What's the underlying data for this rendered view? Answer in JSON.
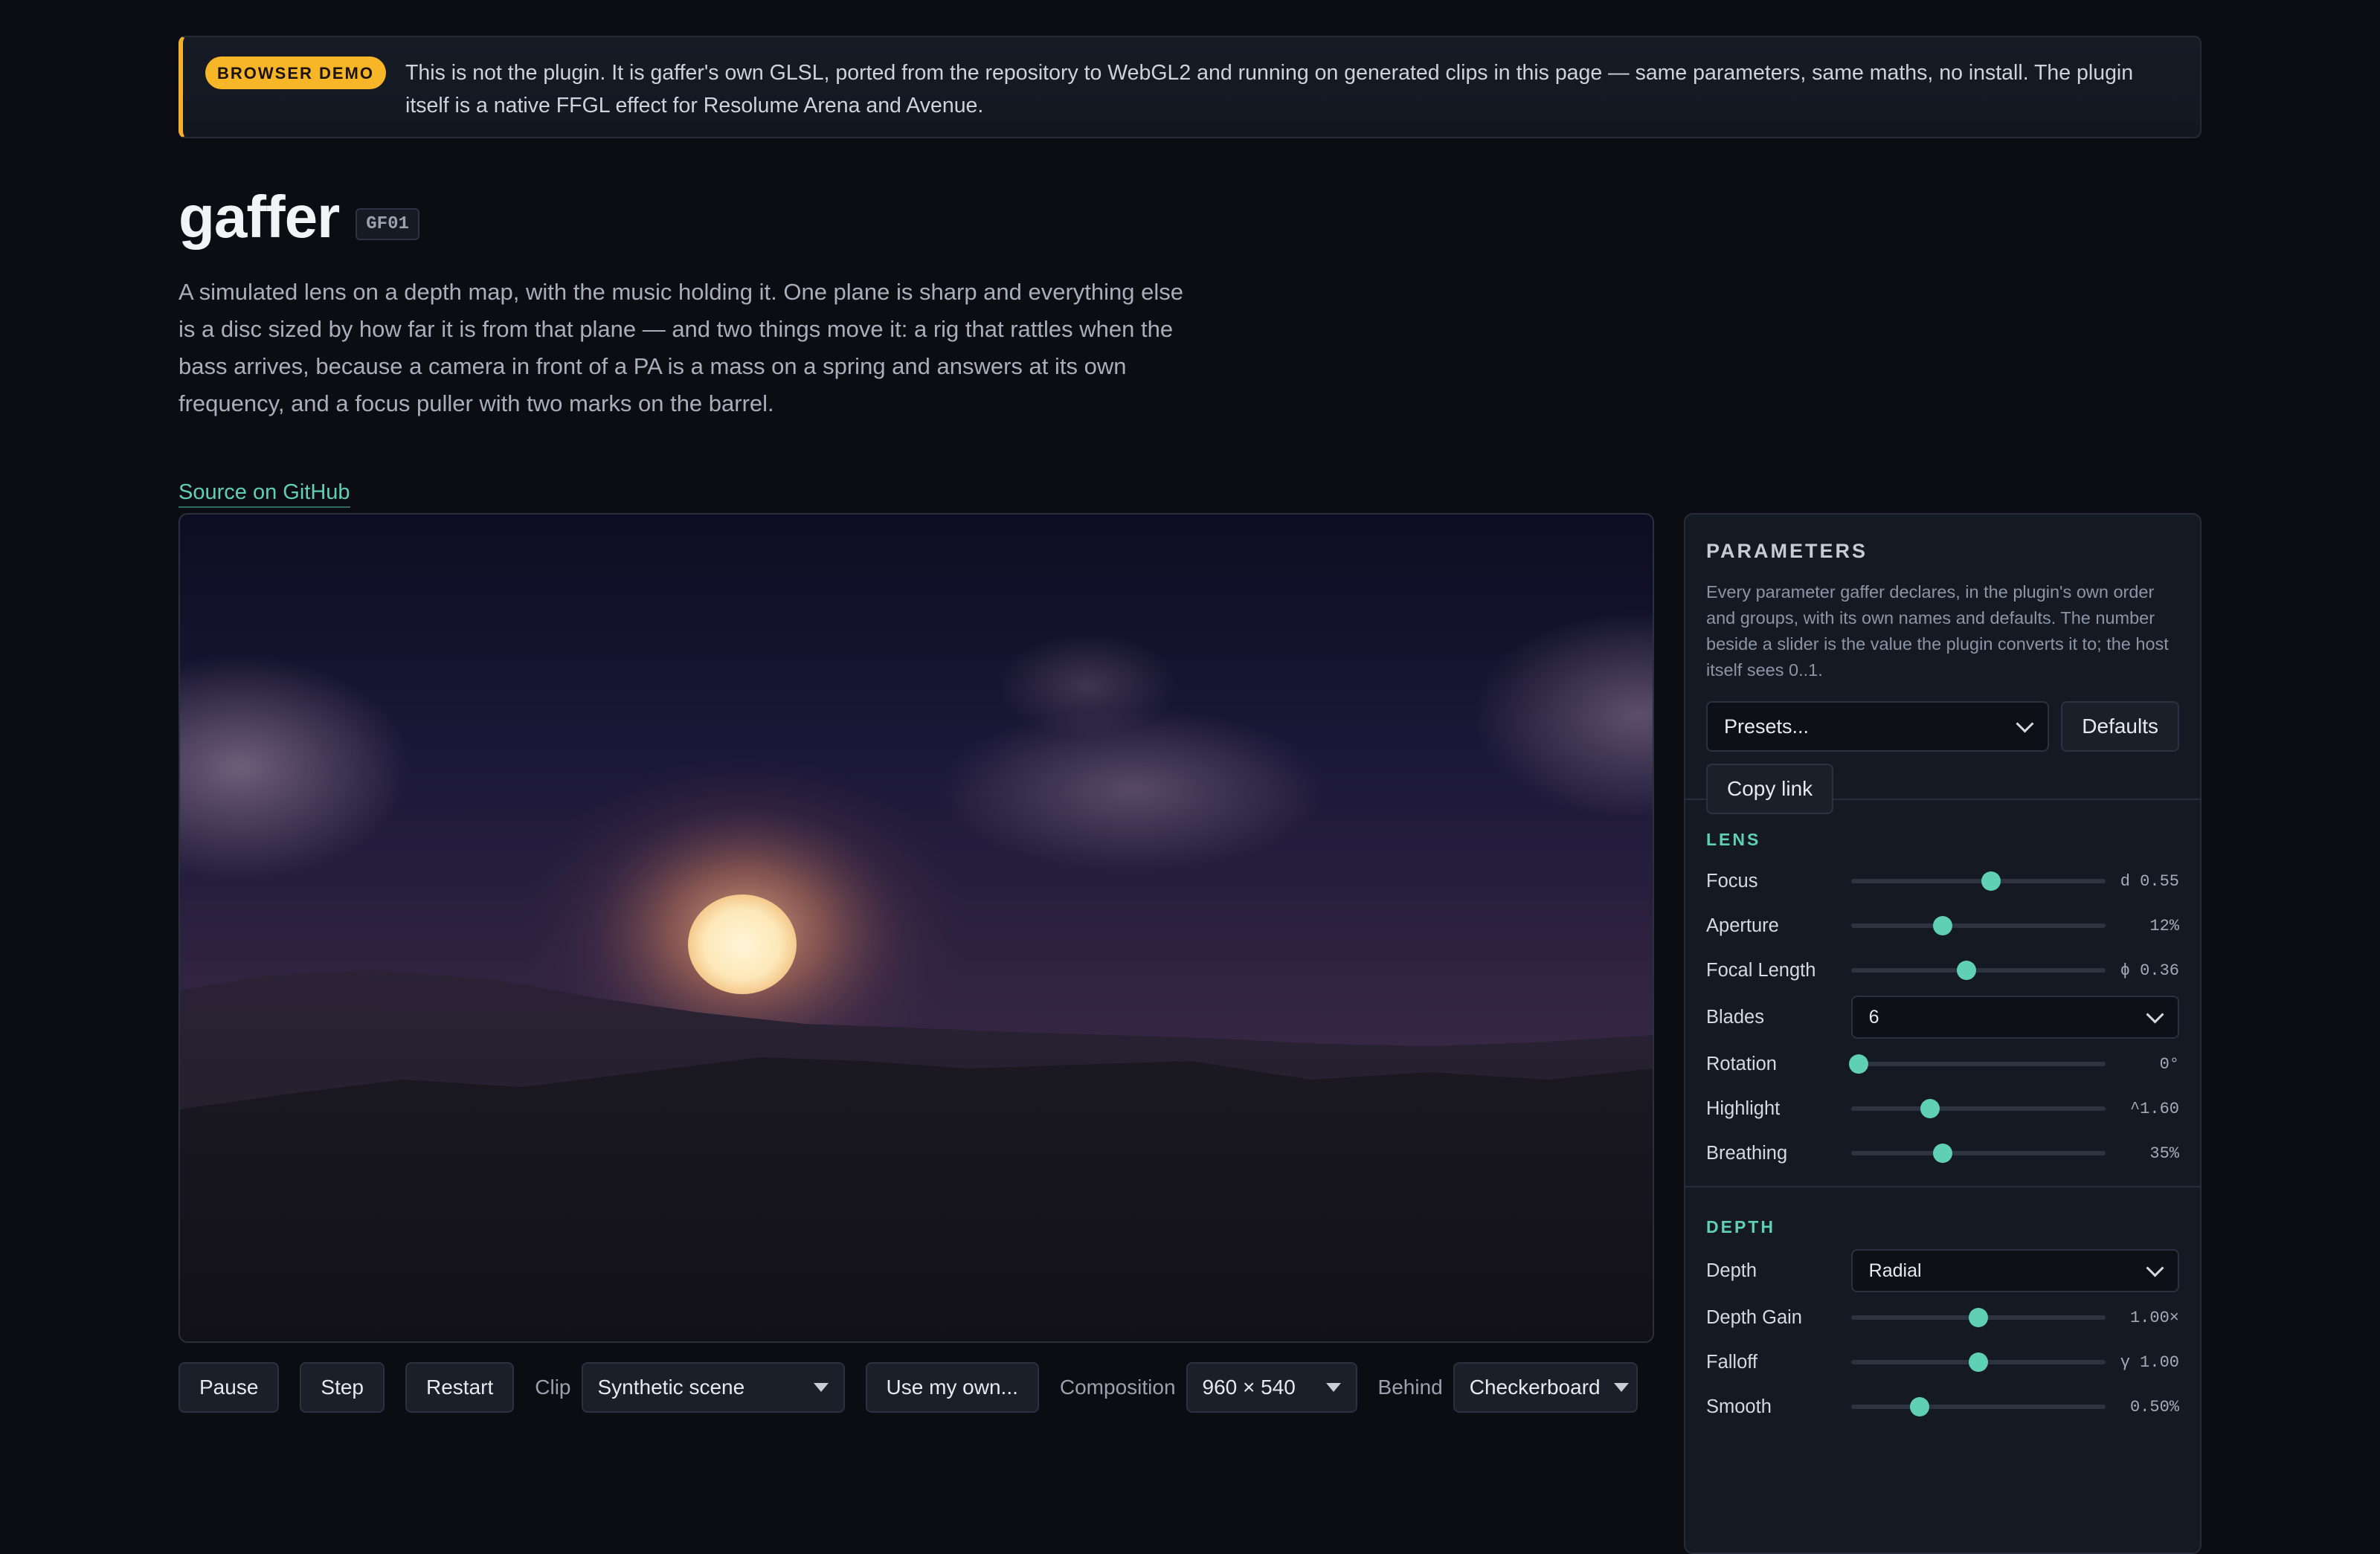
{
  "banner": {
    "badge": "BROWSER DEMO",
    "text": "This is not the plugin. It is gaffer's own GLSL, ported from the repository to WebGL2 and running on generated clips in this page — same parameters, same maths, no install. The plugin itself is a native FFGL effect for Resolume Arena and Avenue."
  },
  "header": {
    "title": "gaffer",
    "code": "GF01",
    "description": "A simulated lens on a depth map, with the music holding it. One plane is sharp and everything else is a disc sized by how far it is from that plane — and two things move it: a rig that rattles when the bass arrives, because a camera in front of a PA is a mass on a spring and answers at its own frequency, and a focus puller with two marks on the barrel.",
    "source_link": "Source on GitHub"
  },
  "controls": {
    "pause": "Pause",
    "step": "Step",
    "restart": "Restart",
    "clip_label": "Clip",
    "clip_value": "Synthetic scene",
    "use_own": "Use my own...",
    "composition_label": "Composition",
    "composition_value": "960 × 540",
    "behind_label": "Behind",
    "behind_value": "Checkerboard"
  },
  "panel": {
    "title": "PARAMETERS",
    "description": "Every parameter gaffer declares, in the plugin's own order and groups, with its own names and defaults. The number beside a slider is the value the plugin converts it to; the host itself sees 0..1.",
    "presets_placeholder": "Presets...",
    "defaults": "Defaults",
    "copy_link": "Copy link",
    "lens": {
      "title": "LENS",
      "params": [
        {
          "label": "Focus",
          "value": "d 0.55",
          "level": 0.55
        },
        {
          "label": "Aperture",
          "value": "12%",
          "level": 0.36
        },
        {
          "label": "Focal Length",
          "value": "ϕ 0.36",
          "level": 0.455
        },
        {
          "label": "Blades",
          "select": "6"
        },
        {
          "label": "Rotation",
          "value": "0°",
          "level": 0.03
        },
        {
          "label": "Highlight",
          "value": "^1.60",
          "level": 0.31
        },
        {
          "label": "Breathing",
          "value": "35%",
          "level": 0.36
        }
      ]
    },
    "depth": {
      "title": "DEPTH",
      "params": [
        {
          "label": "Depth",
          "select": "Radial"
        },
        {
          "label": "Depth Gain",
          "value": "1.00×",
          "level": 0.5
        },
        {
          "label": "Falloff",
          "value": "γ 1.00",
          "level": 0.5
        },
        {
          "label": "Smooth",
          "value": "0.50%",
          "level": 0.27
        }
      ]
    }
  },
  "colors": {
    "accent": "#5fd0b6",
    "badge": "#f7b528",
    "background": "#0b0d12"
  }
}
